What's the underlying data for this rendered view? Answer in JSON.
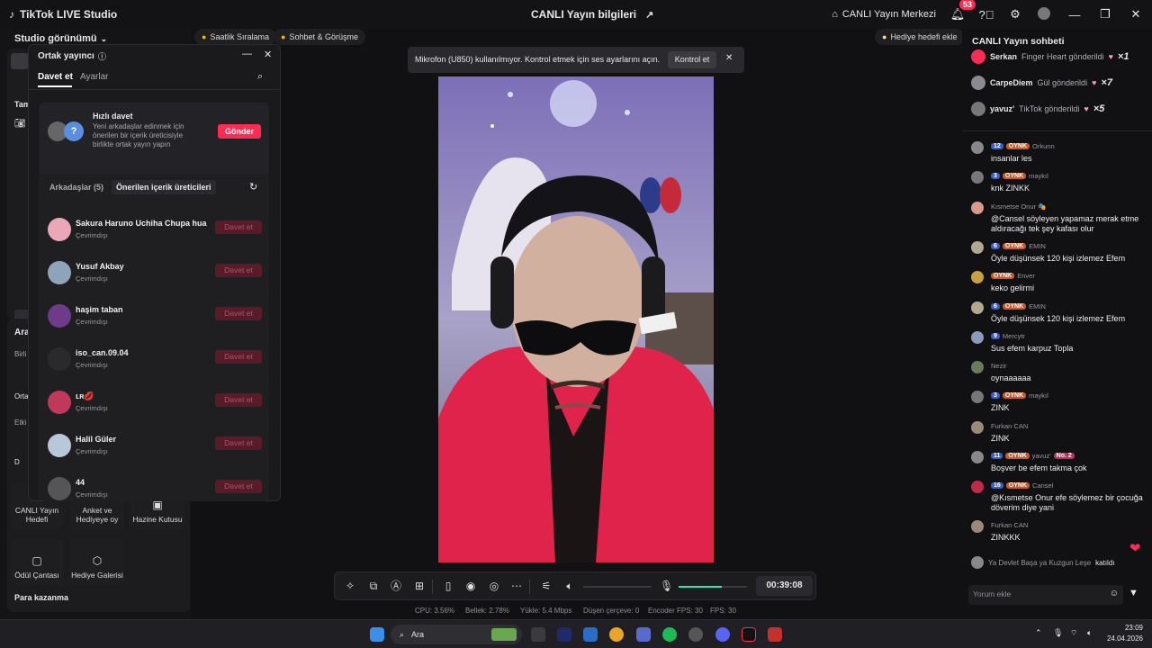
{
  "titlebar": {
    "app_name": "TikTok LIVE Studio",
    "center_title": "CANLI Yayın bilgileri",
    "live_center": "CANLI Yayın Merkezi",
    "notif_count": "53"
  },
  "left": {
    "studio_view": "Studio görünümü",
    "tam_label": "Tam",
    "ara_label": "Ara",
    "birli_label": "Birli",
    "orta_label": "Orta",
    "etki_label": "Etki",
    "tiles": [
      {
        "label": "CANLI Yayın Hedefi"
      },
      {
        "label": "Anket ve Hediyeye oy"
      },
      {
        "label": "Hazine Kutusu"
      },
      {
        "label": "Ödül Çantası"
      },
      {
        "label": "Hediye Galerisi"
      }
    ],
    "para_kazanma": "Para kazanma"
  },
  "top_pills": {
    "hourly_rank": "Saatlik Sıralama",
    "chat_meet": "Sohbet & Görüşme",
    "gift_goal": "Hediye hedefi ekle"
  },
  "dialog": {
    "title": "Ortak yayıncı",
    "tab_invite": "Davet et",
    "tab_settings": "Ayarlar",
    "quick_title": "Hızlı davet",
    "quick_desc": "Yeni arkadaşlar edinmek için önerilen bir içerik üreticisiyle birlikte ortak yayın yapın",
    "send_button": "Gönder",
    "tab_friends": "Arkadaşlar (5)",
    "tab_suggested": "Önerilen içerik üreticileri",
    "invite_label": "Davet et",
    "rows": [
      {
        "name": "Sakura Haruno Uchiha Chupa hua",
        "status": "Çevrimdışı",
        "color": "#e9a7b8"
      },
      {
        "name": "Yusuf Akbay",
        "status": "Çevrimdışı",
        "color": "#8fa4b8"
      },
      {
        "name": "haşim taban",
        "status": "Çevrimdışı",
        "color": "#6e3a8a"
      },
      {
        "name": "iso_can.09.04",
        "status": "Çevrimdışı",
        "color": "#2a2a2a"
      },
      {
        "name": "ʟʀ💋",
        "status": "Çevrimdışı",
        "color": "#c0395a"
      },
      {
        "name": "Halil Güler",
        "status": "Çevrimdışı",
        "color": "#b8c8d8"
      },
      {
        "name": "44",
        "status": "Çevrimdışı",
        "color": "#555"
      }
    ]
  },
  "toast": {
    "text": "Mikrofon (U850) kullanılmıyor. Kontrol etmek için ses ayarlarını açın.",
    "button": "Kontrol et"
  },
  "controls": {
    "timer": "00:39:08"
  },
  "stats": {
    "cpu": "CPU: 3.56%",
    "mem": "Bellek: 2.78%",
    "upload": "Yükle: 5.4 Mbps",
    "dropped": "Düşen çerçeve: 0",
    "encoder_fps": "Encoder FPS: 30",
    "fps": "FPS: 30"
  },
  "chat": {
    "title": "CANLI Yayın sohbeti",
    "gifts": [
      {
        "user": "Serkan",
        "text": "Finger Heart gönderildi",
        "count": "×1"
      },
      {
        "user": "CarpeDiem",
        "text": "Gül gönderildi",
        "count": "×7"
      },
      {
        "user": "yavuz'",
        "text": "TikTok gönderildi",
        "count": "×5"
      }
    ],
    "messages": [
      {
        "lv": "12",
        "oy": "OYNK",
        "user": "Orkunn",
        "text": "insanlar les"
      },
      {
        "lv": "3",
        "oy": "OYNK",
        "user": "maykıl",
        "text": "knk ZINKK"
      },
      {
        "lv": "",
        "oy": "",
        "user": "Kısmetse Onur 🎭",
        "text": "@Cansel söyleyen yapamaz merak etme aldıracağı tek şey kafası olur"
      },
      {
        "lv": "6",
        "oy": "OYNK",
        "user": "EMIN",
        "text": "Öyle düşünsek 120 kişi izlemez Efem"
      },
      {
        "lv": "",
        "oy": "OYNK",
        "user": "Enver",
        "text": "keko gelirmi"
      },
      {
        "lv": "6",
        "oy": "OYNK",
        "user": "EMIN",
        "text": "Öyle düşünsek 120 kişi izlemez Efem"
      },
      {
        "lv": "9",
        "oy": "",
        "user": "Mercytr",
        "text": "Sus efem karpuz Topla"
      },
      {
        "lv": "",
        "oy": "",
        "user": "Nezir",
        "text": "oynaaaaaa"
      },
      {
        "lv": "3",
        "oy": "OYNK",
        "user": "maykıl",
        "text": "ZINK"
      },
      {
        "lv": "",
        "oy": "",
        "user": "Furkan CAN",
        "text": "ZINK"
      },
      {
        "lv": "11",
        "oy": "OYNK",
        "user": "yavuz'",
        "text": "Boşver be efem takma çok",
        "rank": "No. 2"
      },
      {
        "lv": "16",
        "oy": "OYNK",
        "user": "Cansel",
        "text": "@Kısmetse Onur efe söylemez bir çocuğa döverim diye yani"
      },
      {
        "lv": "",
        "oy": "",
        "user": "Furkan CAN",
        "text": "ZINKKK"
      }
    ],
    "joined_user": "Ya Devlet Başa ya Kuzgun Leşe",
    "joined_text": "katıldı",
    "input_placeholder": "Yorum ekle"
  },
  "taskbar": {
    "search": "Ara",
    "time": "23:09",
    "date": "24.04.2026"
  }
}
